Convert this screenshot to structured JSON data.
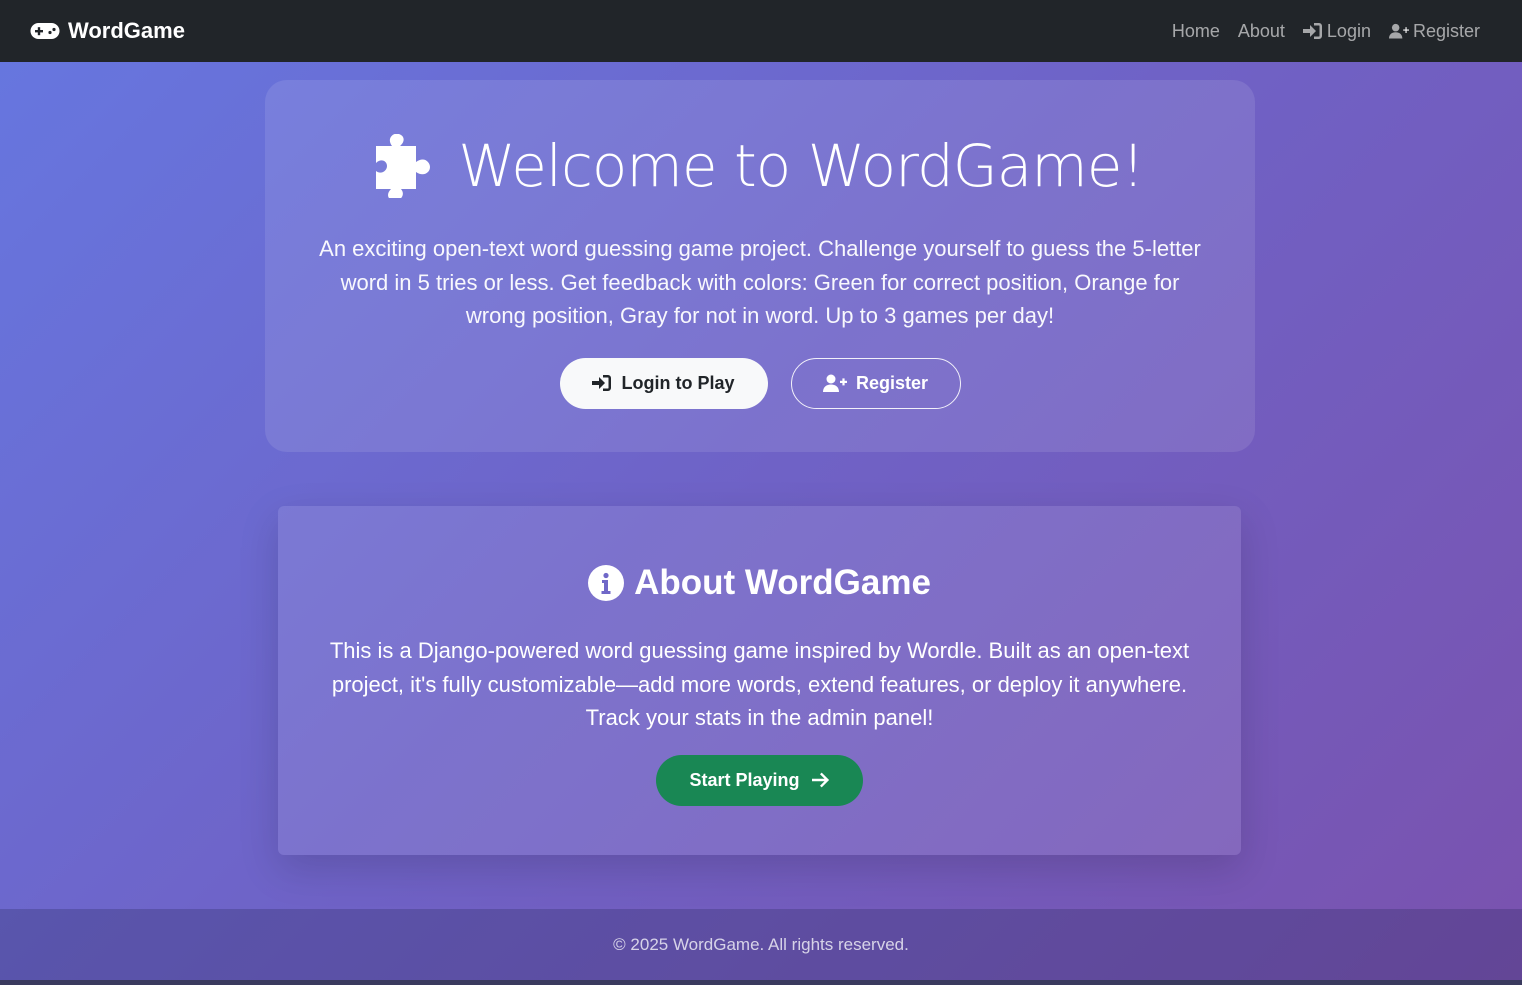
{
  "navbar": {
    "brand": "WordGame",
    "brand_icon": "gamepad-icon",
    "links": [
      {
        "label": "Home",
        "icon": null
      },
      {
        "label": "About",
        "icon": null
      },
      {
        "label": "Login",
        "icon": "sign-in-icon"
      },
      {
        "label": "Register",
        "icon": "user-plus-icon"
      }
    ]
  },
  "hero": {
    "icon": "puzzle-icon",
    "title": "Welcome to WordGame!",
    "description": "An exciting open-text word guessing game project. Challenge yourself to guess the 5-letter word in 5 tries or less. Get feedback with colors: Green for correct position, Orange for wrong position, Gray for not in word. Up to 3 games per day!",
    "login_button": "Login to Play",
    "register_button": "Register"
  },
  "about": {
    "icon": "info-circle-icon",
    "title": "About WordGame",
    "description": "This is a Django-powered word guessing game inspired by Wordle. Built as an open-text project, it's fully customizable—add more words, extend features, or deploy it anywhere. Track your stats in the admin panel!",
    "start_button": "Start Playing"
  },
  "footer": {
    "text": "© 2025 WordGame. All rights reserved."
  },
  "colors": {
    "navbar": "#212529",
    "success": "#198754",
    "gradient_start": "#6677e0",
    "gradient_end": "#7a52ae"
  }
}
